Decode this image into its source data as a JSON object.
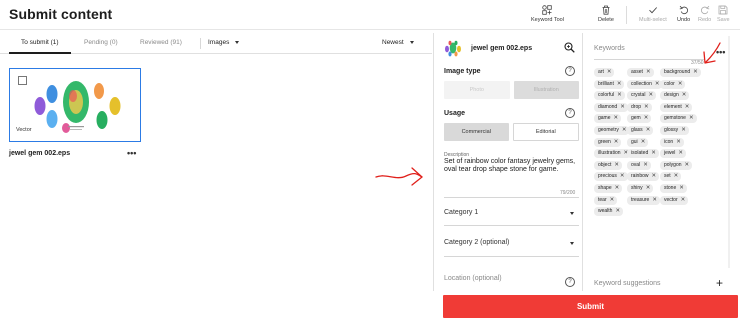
{
  "header": {
    "title": "Submit content",
    "tools": {
      "keyword_tool": "Keyword Tool",
      "delete": "Delete",
      "multi_select": "Multi-select",
      "undo": "Undo",
      "redo": "Redo",
      "save": "Save"
    }
  },
  "tabs": [
    {
      "label": "To submit (1)",
      "active": true
    },
    {
      "label": "Pending (0)",
      "active": false
    },
    {
      "label": "Reviewed (91)",
      "active": false
    }
  ],
  "filters": {
    "type": "Images",
    "sort": "Newest"
  },
  "asset": {
    "file_name": "jewel gem 002.eps",
    "badge": "Vector",
    "more": "•••"
  },
  "details": {
    "title": "jewel gem 002.eps",
    "image_type": {
      "label": "Image type",
      "options": [
        "Photo",
        "Illustration"
      ],
      "selected": "Illustration",
      "disabled": true
    },
    "usage": {
      "label": "Usage",
      "options": [
        "Commercial",
        "Editorial"
      ],
      "selected": "Commercial"
    },
    "description": {
      "label": "Description",
      "value": "Set of rainbow color fantasy jewelry gems, oval tear drop shape stone for game.",
      "count": "79/200"
    },
    "category1": "Category 1",
    "category2": "Category 2 (optional)",
    "location": "Location (optional)",
    "help": "?"
  },
  "keywords": {
    "label": "Keywords",
    "count": "37/50",
    "more": "•••",
    "remove_glyph": "✕",
    "items": [
      "art",
      "asset",
      "background",
      "brilliant",
      "collection",
      "color",
      "colorful",
      "crystal",
      "design",
      "diamond",
      "drop",
      "element",
      "game",
      "gem",
      "gemstone",
      "geometry",
      "glass",
      "glossy",
      "green",
      "gui",
      "icon",
      "illustration",
      "isolated",
      "jewel",
      "object",
      "oval",
      "polygon",
      "precious",
      "rainbow",
      "set",
      "shape",
      "shiny",
      "stone",
      "tear",
      "treasure",
      "vector",
      "wealth"
    ],
    "suggestions_label": "Keyword suggestions",
    "add_glyph": "+"
  },
  "submit_label": "Submit",
  "colors": {
    "accent": "#f03b36",
    "selection": "#2c7be5",
    "annotation": "#e0201b"
  },
  "icons": [
    "keyword-tool-icon",
    "trash-icon",
    "check-icon",
    "undo-icon",
    "redo-icon",
    "save-icon",
    "zoom-icon",
    "help-icon",
    "plus-icon"
  ]
}
